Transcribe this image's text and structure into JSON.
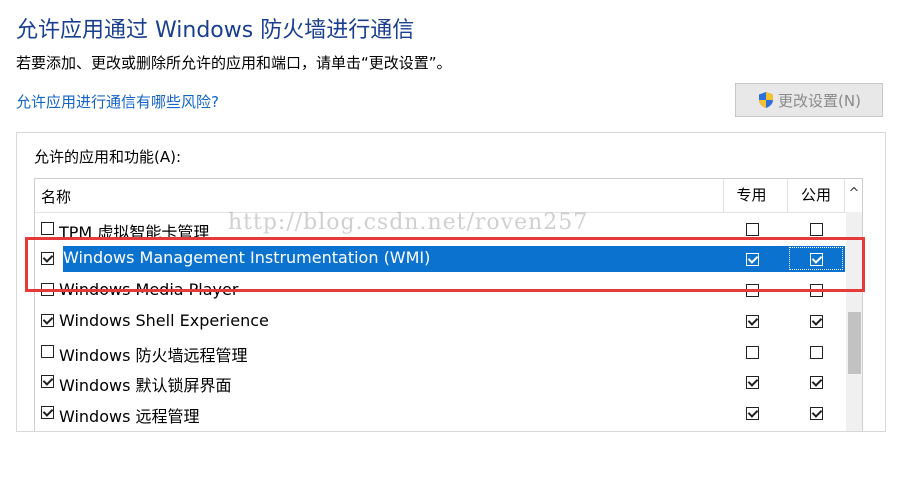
{
  "header": {
    "title": "允许应用通过 Windows 防火墙进行通信",
    "description": "若要添加、更改或删除所允许的应用和端口，请单击“更改设置”。",
    "risk_link": "允许应用进行通信有哪些风险?",
    "change_settings_label": "更改设置(N)"
  },
  "group": {
    "label": "允许的应用和功能(A):",
    "columns": {
      "name": "名称",
      "private": "专用",
      "public": "公用",
      "sort_icon": "^"
    },
    "rows": [
      {
        "label": "TPM 虚拟智能卡管理",
        "enabled": false,
        "private": false,
        "public": false
      },
      {
        "label": "Windows Management Instrumentation (WMI)",
        "enabled": true,
        "private": true,
        "public": true,
        "selected": true
      },
      {
        "label": "Windows Media Player",
        "enabled": false,
        "private": false,
        "public": false
      },
      {
        "label": "Windows Shell Experience",
        "enabled": true,
        "private": true,
        "public": true
      },
      {
        "label": "Windows 防火墙远程管理",
        "enabled": false,
        "private": false,
        "public": false
      },
      {
        "label": "Windows 默认锁屏界面",
        "enabled": true,
        "private": true,
        "public": true
      },
      {
        "label": "Windows 远程管理",
        "enabled": true,
        "private": true,
        "public": true
      }
    ]
  },
  "watermark": "http://blog.csdn.net/roven257",
  "colors": {
    "title": "#1a3f8f",
    "link": "#1464c8",
    "selection": "#0b72d0",
    "highlight_box": "#e53a3a"
  }
}
